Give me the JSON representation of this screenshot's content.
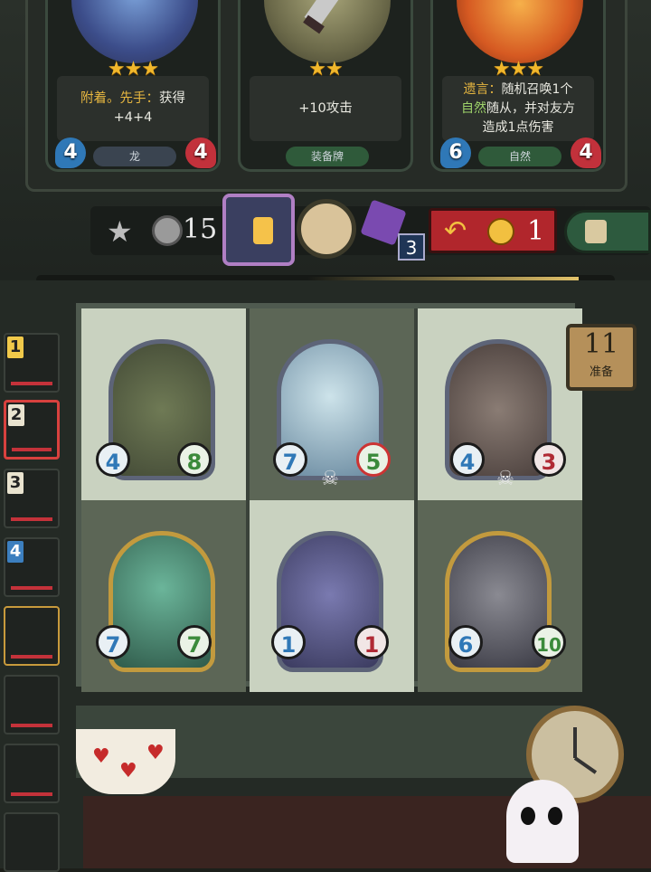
{
  "shop": {
    "cards": [
      {
        "name": "dragon-card",
        "stars": "★★★",
        "text_parts": [
          "附着。",
          "先手：",
          "获得",
          "+4+4"
        ],
        "tribe": "龙",
        "attack": "4",
        "health": "4",
        "art_color": "#3c4d8a"
      },
      {
        "name": "sword-card",
        "stars": "★★",
        "text": "+10攻击",
        "tribe": "装备牌",
        "art_color": "#6c6a4a"
      },
      {
        "name": "fire-card",
        "stars": "★★★",
        "text_line1_a": "遗言：",
        "text_line1_b": "随机召唤1个",
        "text_line2_a": "自然",
        "text_line2_b": "随从，并对友方",
        "text_line3": "造成1点伤害",
        "tribe": "自然",
        "attack": "6",
        "health": "4",
        "art_color": "#d65a22"
      }
    ]
  },
  "resources": {
    "coins": "15",
    "potion_count": "3",
    "refresh_cost": "1"
  },
  "timer": {
    "value": "11",
    "label": "准备"
  },
  "board": {
    "minions": [
      {
        "name": "rock-golem",
        "attack": "4",
        "health": "8",
        "frame": "silver"
      },
      {
        "name": "yeti-fairy",
        "attack": "7",
        "health": "5",
        "frame": "silver",
        "skull": true,
        "health_damaged": true
      },
      {
        "name": "ox-beast",
        "attack": "4",
        "health": "3",
        "frame": "silver",
        "skull": true
      },
      {
        "name": "green-shaman",
        "attack": "7",
        "health": "7",
        "frame": "gold"
      },
      {
        "name": "firefly-bug",
        "attack": "1",
        "health": "1",
        "frame": "silver"
      },
      {
        "name": "witch-raccoon",
        "attack": "6",
        "health": "10",
        "frame": "gold"
      }
    ]
  },
  "sidebar": {
    "players": [
      {
        "rank": "1"
      },
      {
        "rank": "2"
      },
      {
        "rank": "3"
      },
      {
        "rank": "4"
      },
      {
        "rank": ""
      },
      {
        "rank": ""
      },
      {
        "rank": ""
      },
      {
        "rank": ""
      }
    ]
  },
  "colors": {
    "accent_gold": "#e6b640",
    "accent_green": "#9ed36a",
    "attack_blue": "#2f78b7",
    "health_red": "#c2313b"
  }
}
